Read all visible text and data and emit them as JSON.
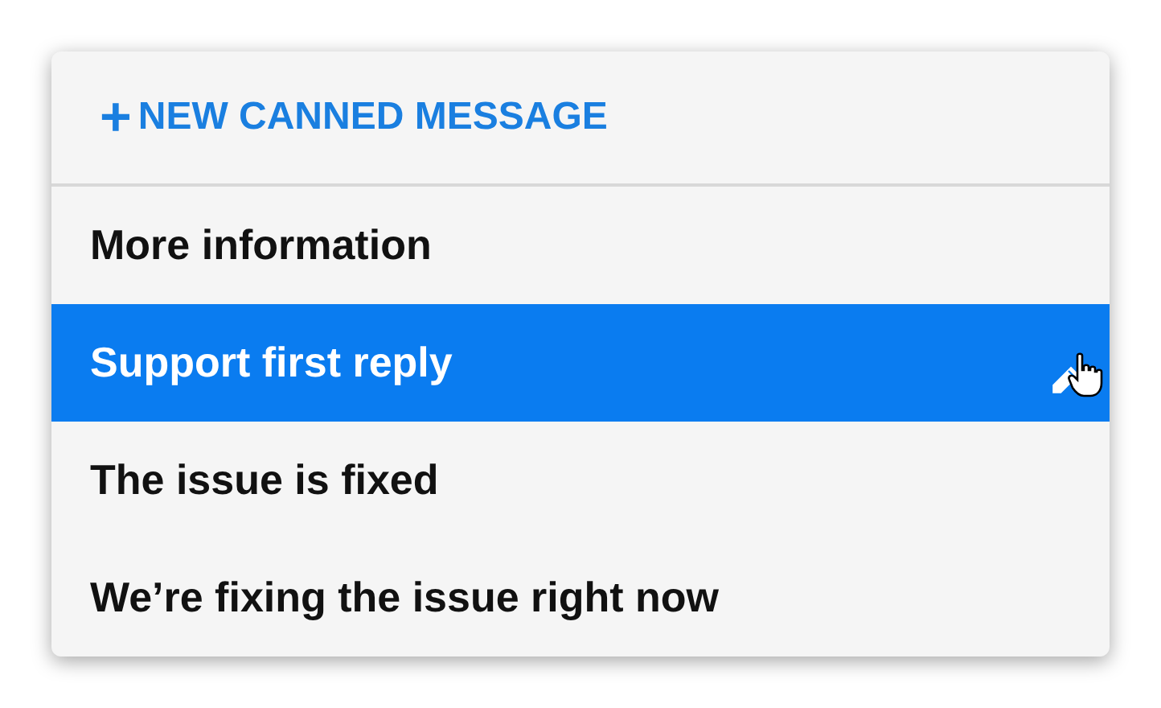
{
  "new_button": {
    "icon": "+",
    "label": "NEW CANNED MESSAGE"
  },
  "messages": [
    {
      "label": "More information",
      "selected": false
    },
    {
      "label": "Support first reply",
      "selected": true
    },
    {
      "label": "The issue is fixed",
      "selected": false
    },
    {
      "label": "We’re fixing the issue right now",
      "selected": false
    }
  ]
}
